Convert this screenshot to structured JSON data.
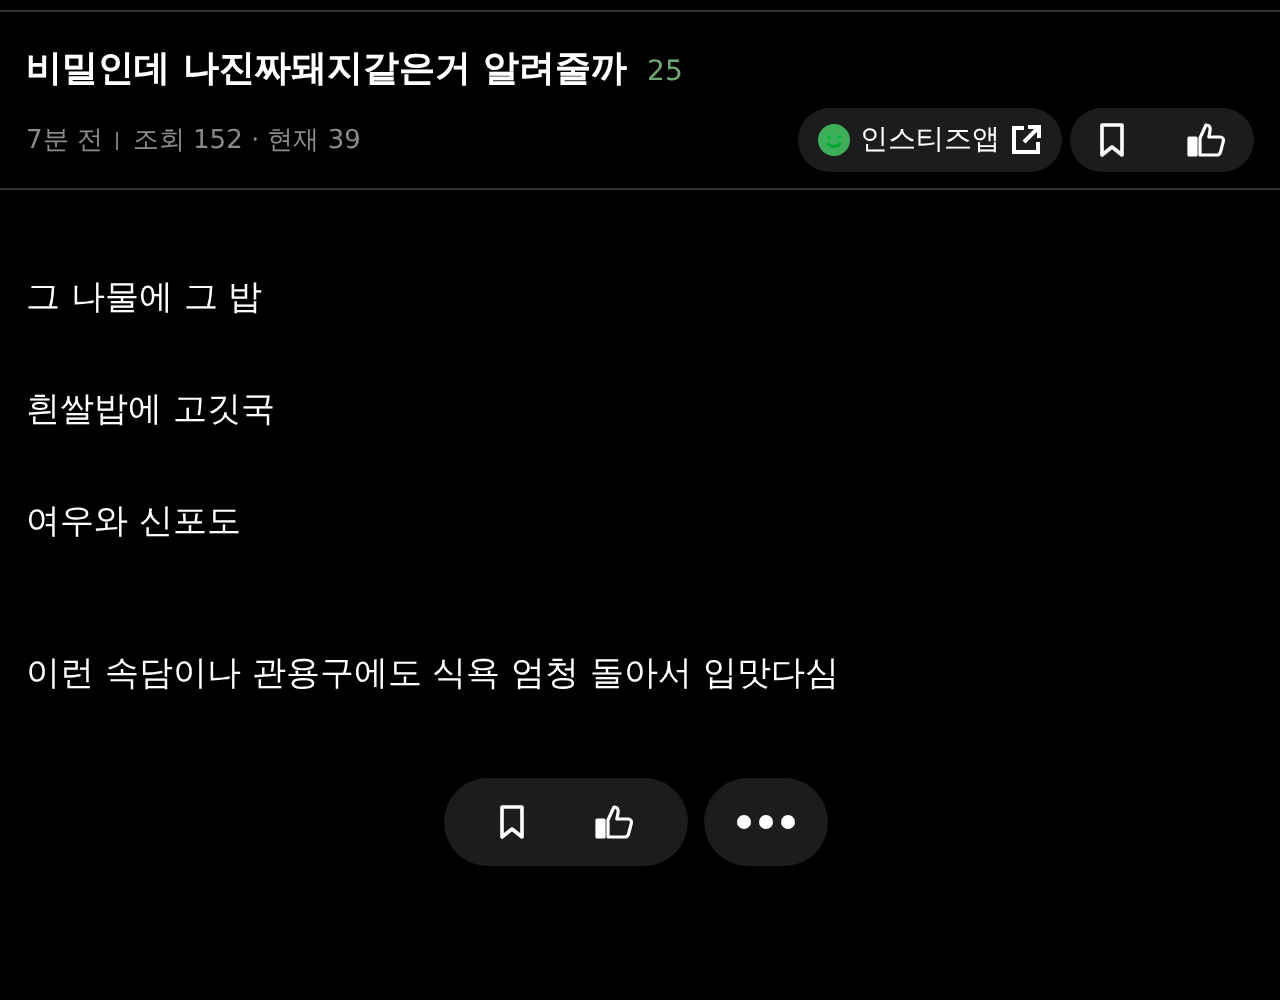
{
  "post": {
    "title": "비밀인데 나진짜돼지같은거 알려줄까",
    "comment_count": "25",
    "time": "7분 전",
    "views": "조회 152 · 현재 39",
    "app_link": "인스티즈앱"
  },
  "body": [
    "그 나물에 그 밥",
    "흰쌀밥에 고깃국",
    "여우와 신포도",
    "이런 속담이나 관용구에도 식욕 엄청 돌아서 입맛다심"
  ]
}
